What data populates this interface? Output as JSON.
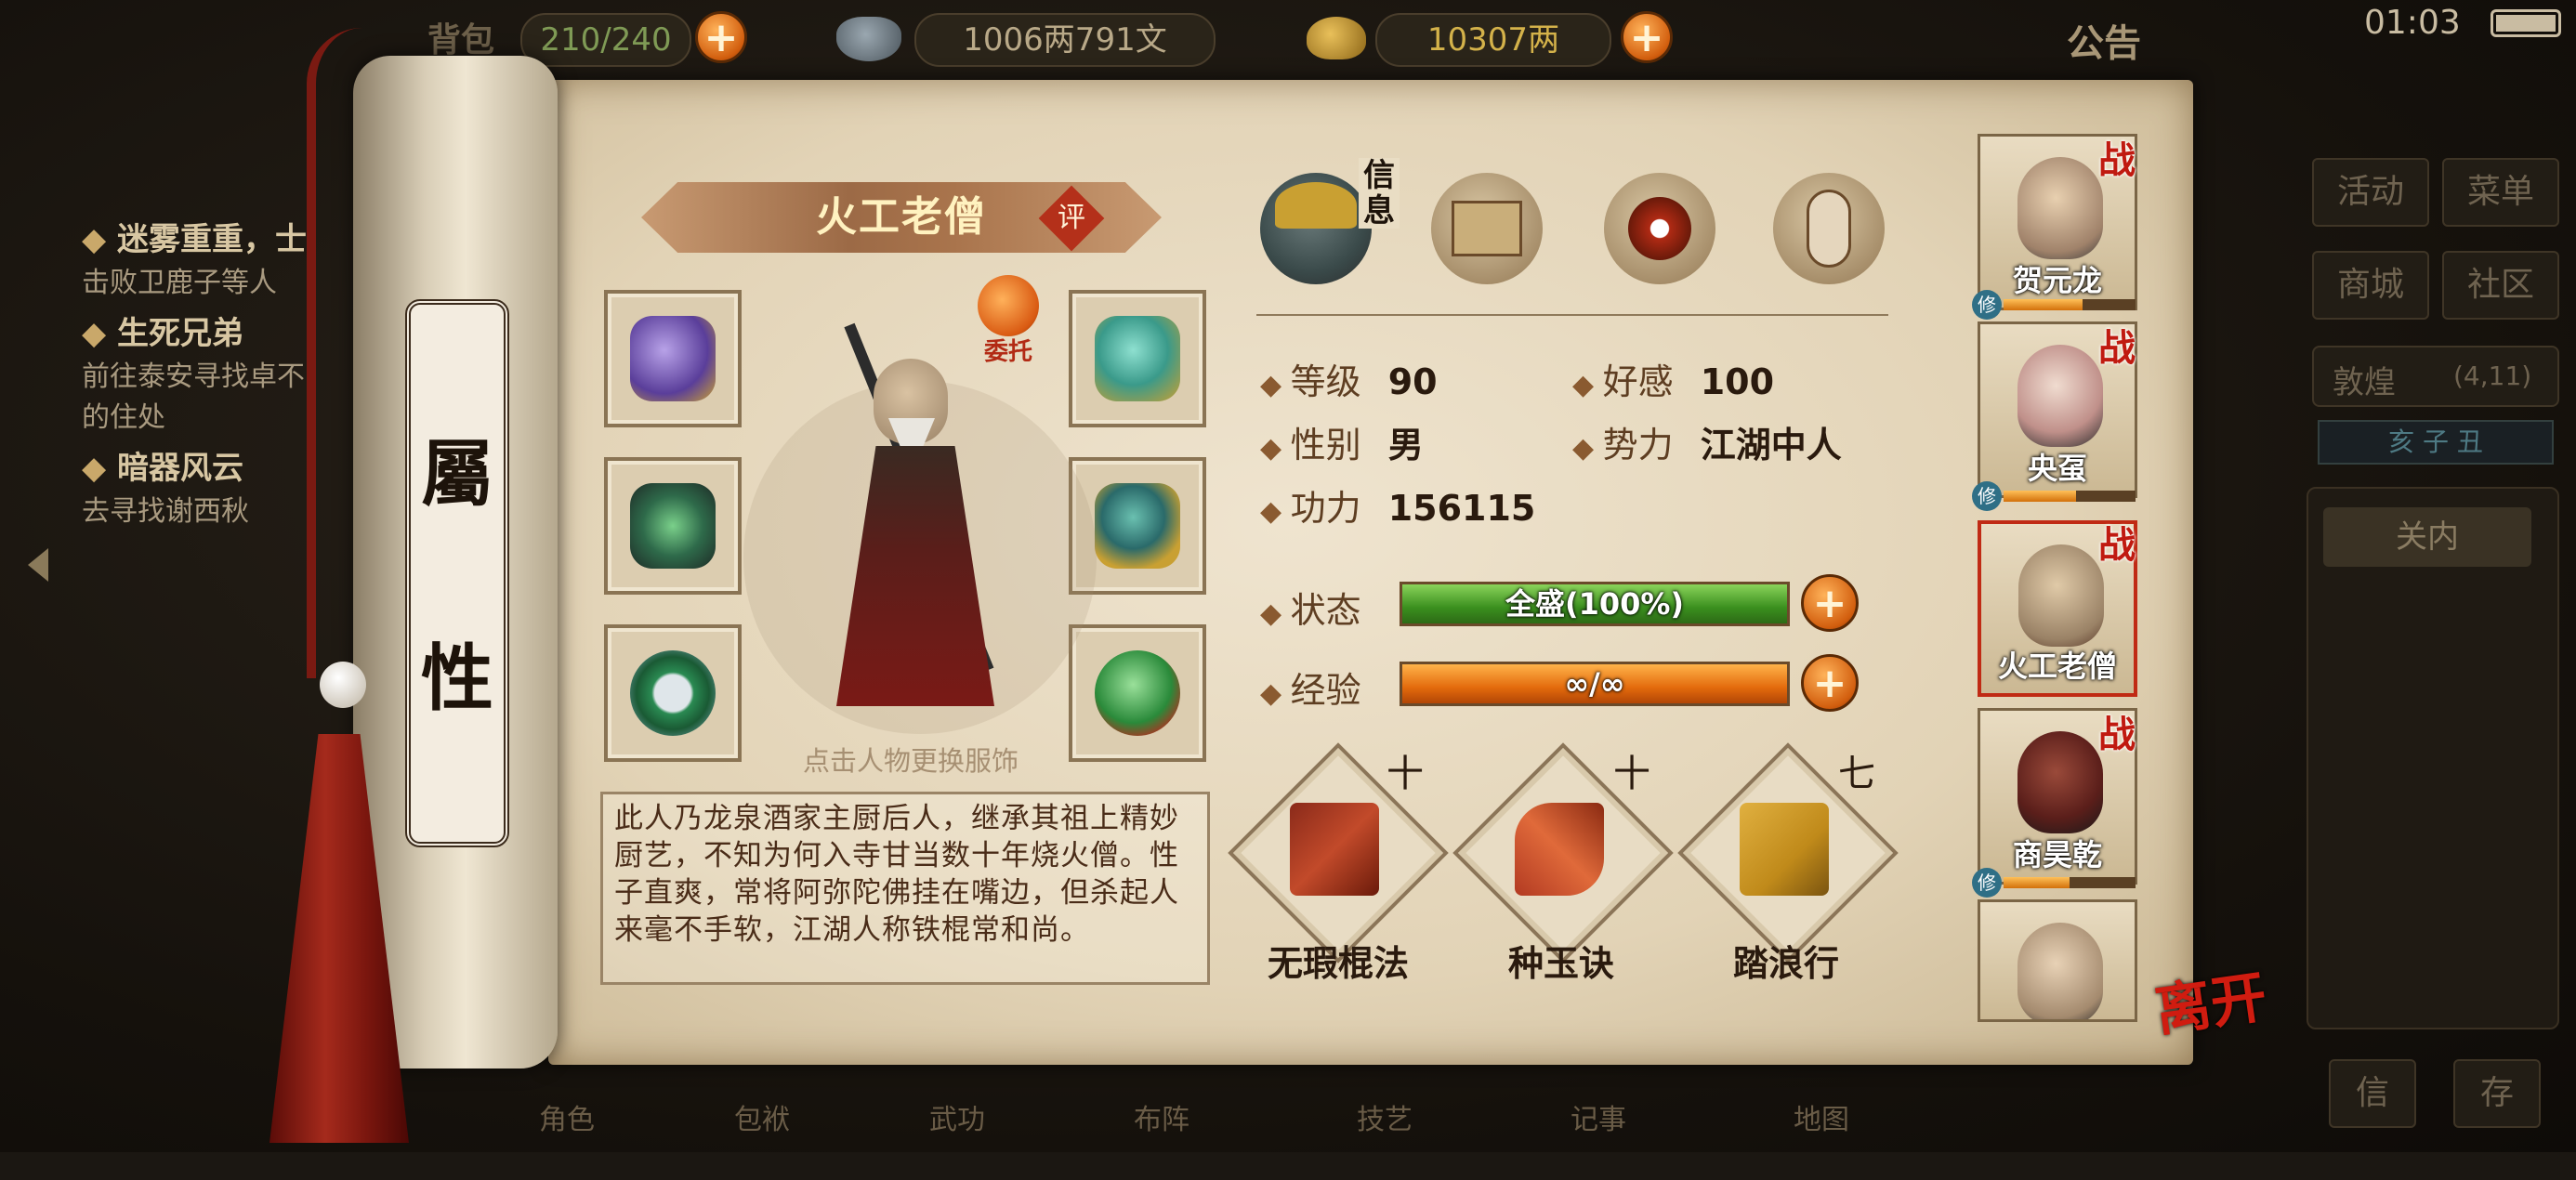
{
  "topbar": {
    "bag_label": "背包",
    "bag_count": "210/240",
    "money": "1006两791文",
    "gold": "10307两",
    "notice": "公告",
    "clock": "01:03"
  },
  "quests": [
    {
      "title": "迷雾重重，士",
      "desc": "击败卫鹿子等人"
    },
    {
      "title": "生死兄弟",
      "desc": "前往泰安寻找卓不",
      "desc2": "的住处"
    },
    {
      "title": "暗器风云",
      "desc": "去寻找谢西秋"
    }
  ],
  "right_menu": {
    "activity": "活动",
    "menu": "菜单",
    "shop": "商城",
    "community": "社区",
    "location": "敦煌",
    "coords": "(4,11)",
    "compass": "亥 子 丑",
    "map_btn": "关内",
    "msg": "信",
    "save": "存"
  },
  "bottom_tabs": [
    "角色",
    "包袱",
    "武功",
    "布阵",
    "技艺",
    "记事",
    "地图"
  ],
  "scroll": {
    "label_top": "屬",
    "label_bottom": "性"
  },
  "character": {
    "name": "火工老僧",
    "rate": "评",
    "delegate": "委托",
    "outfit_hint": "点击人物更换服饰",
    "bio": "此人乃龙泉酒家主厨后人，继承其祖上精妙厨艺，不知为何入寺甘当数十年烧火僧。性子直爽，常将阿弥陀佛挂在嘴边，但杀起人来毫不手软，江湖人称铁棍常和尚。"
  },
  "tabs": {
    "info_label": "信息"
  },
  "stats": {
    "level_label": "等级",
    "level": "90",
    "favor_label": "好感",
    "favor": "100",
    "gender_label": "性别",
    "gender": "男",
    "faction_label": "势力",
    "faction": "江湖中人",
    "power_label": "功力",
    "power": "156115",
    "status_label": "状态",
    "status_text": "全盛(100%)",
    "status_pct": 100,
    "exp_label": "经验",
    "exp_text": "∞/∞",
    "exp_pct": 100
  },
  "skills": [
    {
      "name": "无瑕棍法",
      "level": "十"
    },
    {
      "name": "种玉诀",
      "level": "十"
    },
    {
      "name": "踏浪行",
      "level": "七"
    }
  ],
  "party": [
    {
      "name": "贺元龙",
      "battle": "战",
      "xiu": "修",
      "bar_pct": 60
    },
    {
      "name": "央虿",
      "battle": "战",
      "xiu": "修",
      "bar_pct": 55
    },
    {
      "name": "火工老僧",
      "battle": "战",
      "xiu": "",
      "bar_pct": 0
    },
    {
      "name": "商昊乾",
      "battle": "战",
      "xiu": "修",
      "bar_pct": 50
    },
    {
      "name": "",
      "battle": "",
      "xiu": "",
      "bar_pct": 0
    }
  ],
  "leave": "离开",
  "colors": {
    "parchment": "#e9dcc4",
    "accent_red": "#c02a14",
    "status_green": "#3a8f1e",
    "exp_orange": "#e36a0c"
  }
}
